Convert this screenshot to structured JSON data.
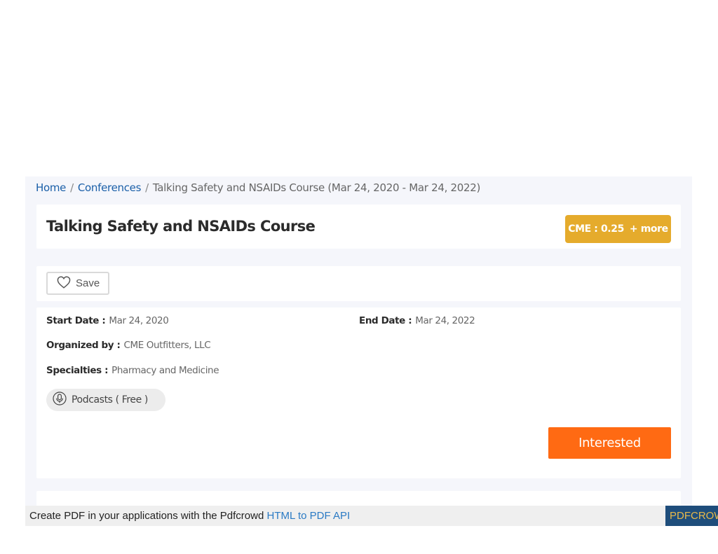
{
  "breadcrumb": {
    "home": "Home",
    "separator": "/",
    "conferences": "Conferences",
    "current": "Talking Safety and NSAIDs Course (Mar 24, 2020 - Mar 24, 2022)"
  },
  "course": {
    "title": "Talking Safety and NSAIDs Course",
    "cme_label": "CME : 0.25",
    "cme_more": "+ more"
  },
  "actions": {
    "save_label": "Save",
    "interested_label": "Interested"
  },
  "details": {
    "start_date_label": "Start Date :",
    "start_date_value": "Mar 24, 2020",
    "end_date_label": "End Date :",
    "end_date_value": "Mar 24, 2022",
    "organized_by_label": "Organized by :",
    "organized_by_value": "CME Outfitters, LLC",
    "specialties_label": "Specialties :",
    "specialties_value": "Pharmacy and Medicine",
    "podcast_label": "Podcasts ( Free )"
  },
  "pdf_bar": {
    "message": "Create PDF in your applications with the Pdfcrowd",
    "link": "HTML to PDF API",
    "brand": "PDFCROWD"
  },
  "colors": {
    "badge": "#e5ab2c",
    "interested": "#ff6a13",
    "link": "#1a5fa8"
  },
  "icons": {
    "save": "heart-icon",
    "podcast": "microphone-icon"
  }
}
